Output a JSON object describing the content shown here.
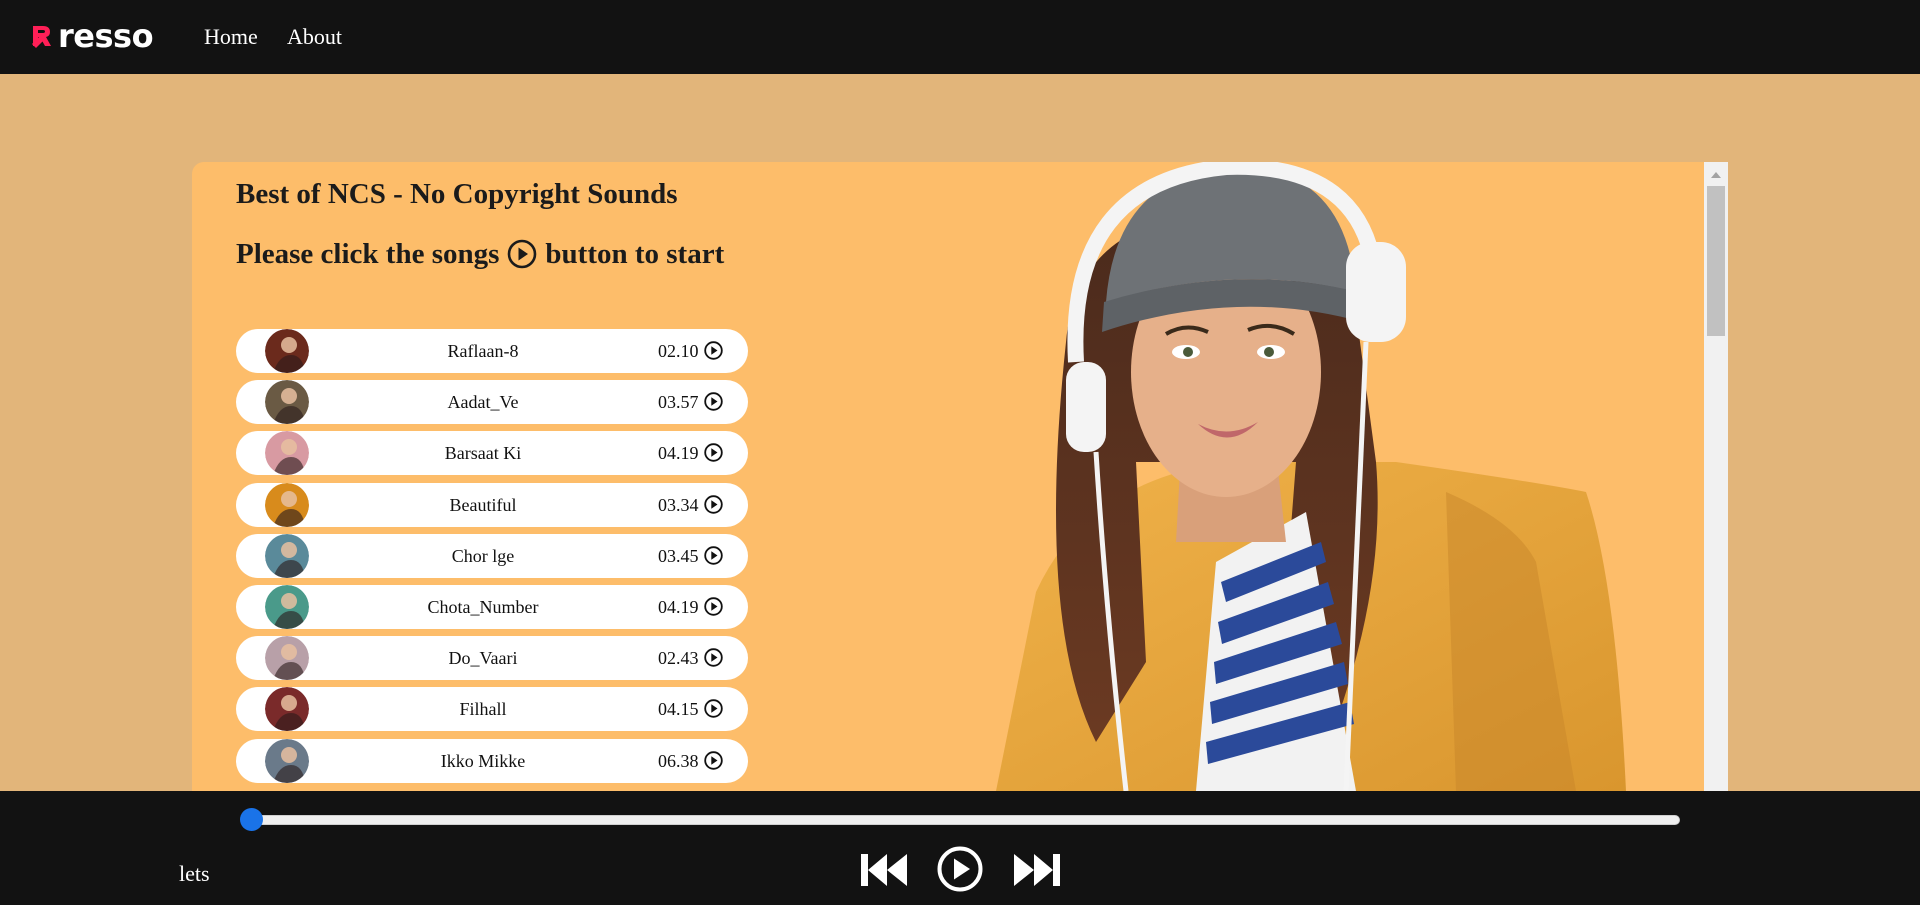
{
  "nav": {
    "logo_text": "resso",
    "links": [
      {
        "label": "Home"
      },
      {
        "label": "About"
      }
    ]
  },
  "main": {
    "title": "Best of NCS - No Copyright Sounds",
    "instruction_prefix": "Please click the songs",
    "instruction_suffix": "button to start",
    "songs": [
      {
        "name": "Raflaan-8",
        "duration": "02.10",
        "color": "#6b2a1c"
      },
      {
        "name": "Aadat_Ve",
        "duration": "03.57",
        "color": "#6a5a44"
      },
      {
        "name": "Barsaat Ki",
        "duration": "04.19",
        "color": "#d89aa2"
      },
      {
        "name": "Beautiful",
        "duration": "03.34",
        "color": "#d88b1c"
      },
      {
        "name": "Chor lge",
        "duration": "03.45",
        "color": "#5a8a9a"
      },
      {
        "name": "Chota_Number",
        "duration": "04.19",
        "color": "#4a9a8a"
      },
      {
        "name": "Do_Vaari",
        "duration": "02.43",
        "color": "#b8a0a8"
      },
      {
        "name": "Filhall",
        "duration": "04.15",
        "color": "#7a2a2a"
      },
      {
        "name": "Ikko Mikke",
        "duration": "06.38",
        "color": "#6a7a8a"
      }
    ]
  },
  "player": {
    "song_info": "lets",
    "progress": 0.0
  },
  "colors": {
    "brand": "#ff1f57",
    "nav_bg": "#121212",
    "page_bg": "#e2b57a",
    "panel_bg": "#fdbd6a",
    "progress_thumb": "#1a73e8"
  }
}
